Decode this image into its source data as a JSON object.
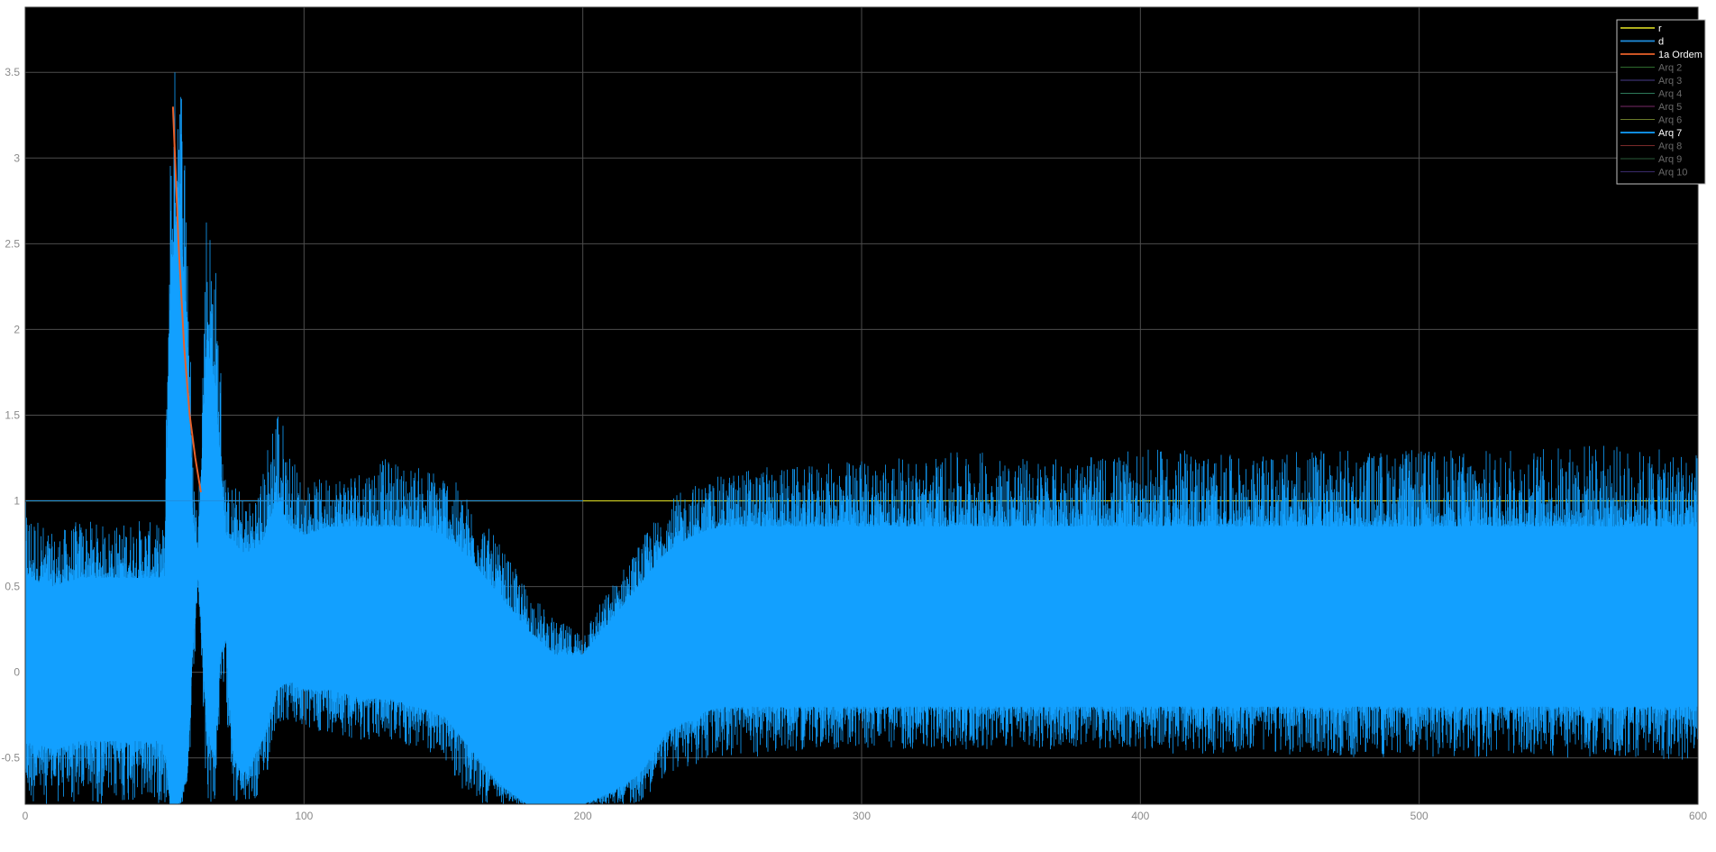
{
  "chart_data": {
    "type": "line",
    "title": "",
    "xlabel": "",
    "ylabel": "",
    "xlim": [
      0,
      600
    ],
    "ylim": [
      -0.77,
      3.88
    ],
    "grid": true,
    "legend_position": "top-right",
    "x_ticks": [
      0,
      100,
      200,
      300,
      400,
      500,
      600
    ],
    "y_ticks": [
      -0.5,
      0,
      0.5,
      1,
      1.5,
      2,
      2.5,
      3,
      3.5
    ],
    "x_tick_labels": [
      "0",
      "100",
      "200",
      "300",
      "400",
      "500",
      "600"
    ],
    "y_tick_labels": [
      "-0.5",
      "0",
      "0.5",
      "1",
      "1.5",
      "2",
      "2.5",
      "3",
      "3.5"
    ],
    "series": [
      {
        "name": "r",
        "color": "#c8c820",
        "highlighted": true,
        "x": [
          0,
          600
        ],
        "values": [
          1,
          1
        ]
      },
      {
        "name": "d",
        "color": "#1f8fe0",
        "highlighted": true,
        "x": [],
        "values": []
      },
      {
        "name": "1a Ordem",
        "color": "#e8602a",
        "highlighted": true,
        "x": [
          53,
          55,
          57,
          59,
          61,
          63
        ],
        "values": [
          3.3,
          2.5,
          1.9,
          1.5,
          1.25,
          1.05
        ]
      },
      {
        "name": "Arq 2",
        "color": "#2e6b2e",
        "highlighted": false
      },
      {
        "name": "Arq 3",
        "color": "#4a3e8c",
        "highlighted": false
      },
      {
        "name": "Arq 4",
        "color": "#2e7a5a",
        "highlighted": false
      },
      {
        "name": "Arq 5",
        "color": "#7a2a6a",
        "highlighted": false
      },
      {
        "name": "Arq 6",
        "color": "#6a7a2a",
        "highlighted": false
      },
      {
        "name": "Arq 7",
        "color": "#12a0ff",
        "highlighted": true,
        "description": "dense noisy signal",
        "x": [
          0,
          10,
          20,
          30,
          40,
          50,
          52,
          55,
          58,
          60,
          62,
          65,
          68,
          70,
          72,
          75,
          78,
          80,
          85,
          90,
          95,
          100,
          110,
          120,
          130,
          140,
          150,
          160,
          170,
          180,
          190,
          200,
          210,
          220,
          230,
          240,
          250,
          260,
          280,
          300,
          320,
          340,
          360,
          380,
          400,
          420,
          440,
          460,
          480,
          500,
          520,
          540,
          560,
          580,
          600
        ],
        "upper": [
          1.0,
          0.8,
          0.9,
          0.85,
          0.9,
          0.85,
          3.2,
          3.85,
          3.0,
          1.3,
          0.9,
          2.8,
          2.5,
          1.9,
          1.1,
          1.1,
          1.05,
          1.0,
          1.15,
          1.65,
          1.3,
          1.1,
          1.15,
          1.2,
          1.25,
          1.2,
          1.2,
          1.0,
          0.75,
          0.5,
          0.3,
          0.25,
          0.5,
          0.75,
          1.0,
          1.1,
          1.15,
          1.2,
          1.2,
          1.25,
          1.25,
          1.3,
          1.25,
          1.25,
          1.3,
          1.3,
          1.25,
          1.3,
          1.3,
          1.3,
          1.3,
          1.3,
          1.35,
          1.3,
          1.3
        ],
        "lower": [
          -0.77,
          -0.77,
          -0.77,
          -0.77,
          -0.77,
          -0.77,
          -0.77,
          -0.77,
          -0.77,
          -0.3,
          0.5,
          -0.77,
          -0.77,
          -0.2,
          -0.2,
          -0.77,
          -0.77,
          -0.77,
          -0.77,
          -0.3,
          -0.3,
          -0.35,
          -0.35,
          -0.4,
          -0.4,
          -0.45,
          -0.5,
          -0.77,
          -0.77,
          -0.77,
          -0.77,
          -0.77,
          -0.77,
          -0.77,
          -0.6,
          -0.55,
          -0.5,
          -0.5,
          -0.45,
          -0.45,
          -0.45,
          -0.45,
          -0.45,
          -0.45,
          -0.45,
          -0.5,
          -0.45,
          -0.5,
          -0.5,
          -0.5,
          -0.5,
          -0.5,
          -0.5,
          -0.5,
          -0.55
        ],
        "core_upper": [
          0.55,
          0.5,
          0.55,
          0.55,
          0.55,
          0.55,
          2.2,
          2.8,
          2.0,
          0.9,
          0.7,
          1.9,
          1.7,
          1.2,
          0.8,
          0.75,
          0.7,
          0.7,
          0.75,
          1.0,
          0.85,
          0.8,
          0.85,
          0.85,
          0.85,
          0.85,
          0.8,
          0.65,
          0.45,
          0.25,
          0.1,
          0.1,
          0.3,
          0.5,
          0.7,
          0.8,
          0.85,
          0.85,
          0.85,
          0.85,
          0.85,
          0.85,
          0.85,
          0.85,
          0.85,
          0.85,
          0.85,
          0.85,
          0.85,
          0.85,
          0.85,
          0.85,
          0.85,
          0.85,
          0.85
        ],
        "core_lower": [
          -0.4,
          -0.45,
          -0.4,
          -0.4,
          -0.4,
          -0.4,
          -0.77,
          -0.77,
          -0.6,
          0.1,
          0.6,
          -0.3,
          -0.5,
          0.1,
          0.2,
          -0.5,
          -0.6,
          -0.55,
          -0.4,
          -0.1,
          -0.05,
          -0.1,
          -0.1,
          -0.15,
          -0.15,
          -0.2,
          -0.25,
          -0.45,
          -0.65,
          -0.77,
          -0.77,
          -0.77,
          -0.7,
          -0.6,
          -0.35,
          -0.25,
          -0.2,
          -0.2,
          -0.2,
          -0.2,
          -0.2,
          -0.2,
          -0.2,
          -0.2,
          -0.2,
          -0.2,
          -0.2,
          -0.2,
          -0.2,
          -0.2,
          -0.2,
          -0.2,
          -0.2,
          -0.2,
          -0.2
        ]
      },
      {
        "name": "Arq 8",
        "color": "#7a2a2a",
        "highlighted": false
      },
      {
        "name": "Arq 9",
        "color": "#2a5a3a",
        "highlighted": false
      },
      {
        "name": "Arq 10",
        "color": "#3a2a6a",
        "highlighted": false
      }
    ]
  }
}
